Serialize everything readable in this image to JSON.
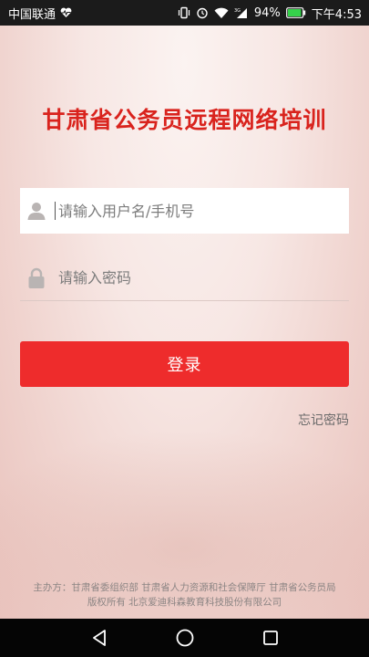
{
  "status_bar": {
    "carrier": "中国联通",
    "battery_percent": "94%",
    "time": "下午4:53",
    "network_type": "3G",
    "icons": [
      "heart-pulse-icon",
      "vibrate-icon",
      "alarm-icon",
      "wifi-icon",
      "signal-icon",
      "battery-icon"
    ],
    "battery_level": 0.94
  },
  "app": {
    "title": "甘肃省公务员远程网络培训",
    "title_color": "#d9231d"
  },
  "login_form": {
    "username_placeholder": "请输入用户名/手机号",
    "password_placeholder": "请输入密码",
    "username_icon": "user-icon",
    "password_icon": "lock-icon",
    "login_label": "登录",
    "login_color": "#ee2c2c",
    "forgot_password": "忘记密码"
  },
  "footer": {
    "sponsors": "主办方：甘肃省委组织部 甘肃省人力资源和社会保障厅 甘肃省公务员局",
    "copyright": "版权所有 北京爱迪科森教育科技股份有限公司"
  },
  "nav_bar": {
    "icons": [
      "back-icon",
      "home-icon",
      "recents-icon"
    ]
  }
}
